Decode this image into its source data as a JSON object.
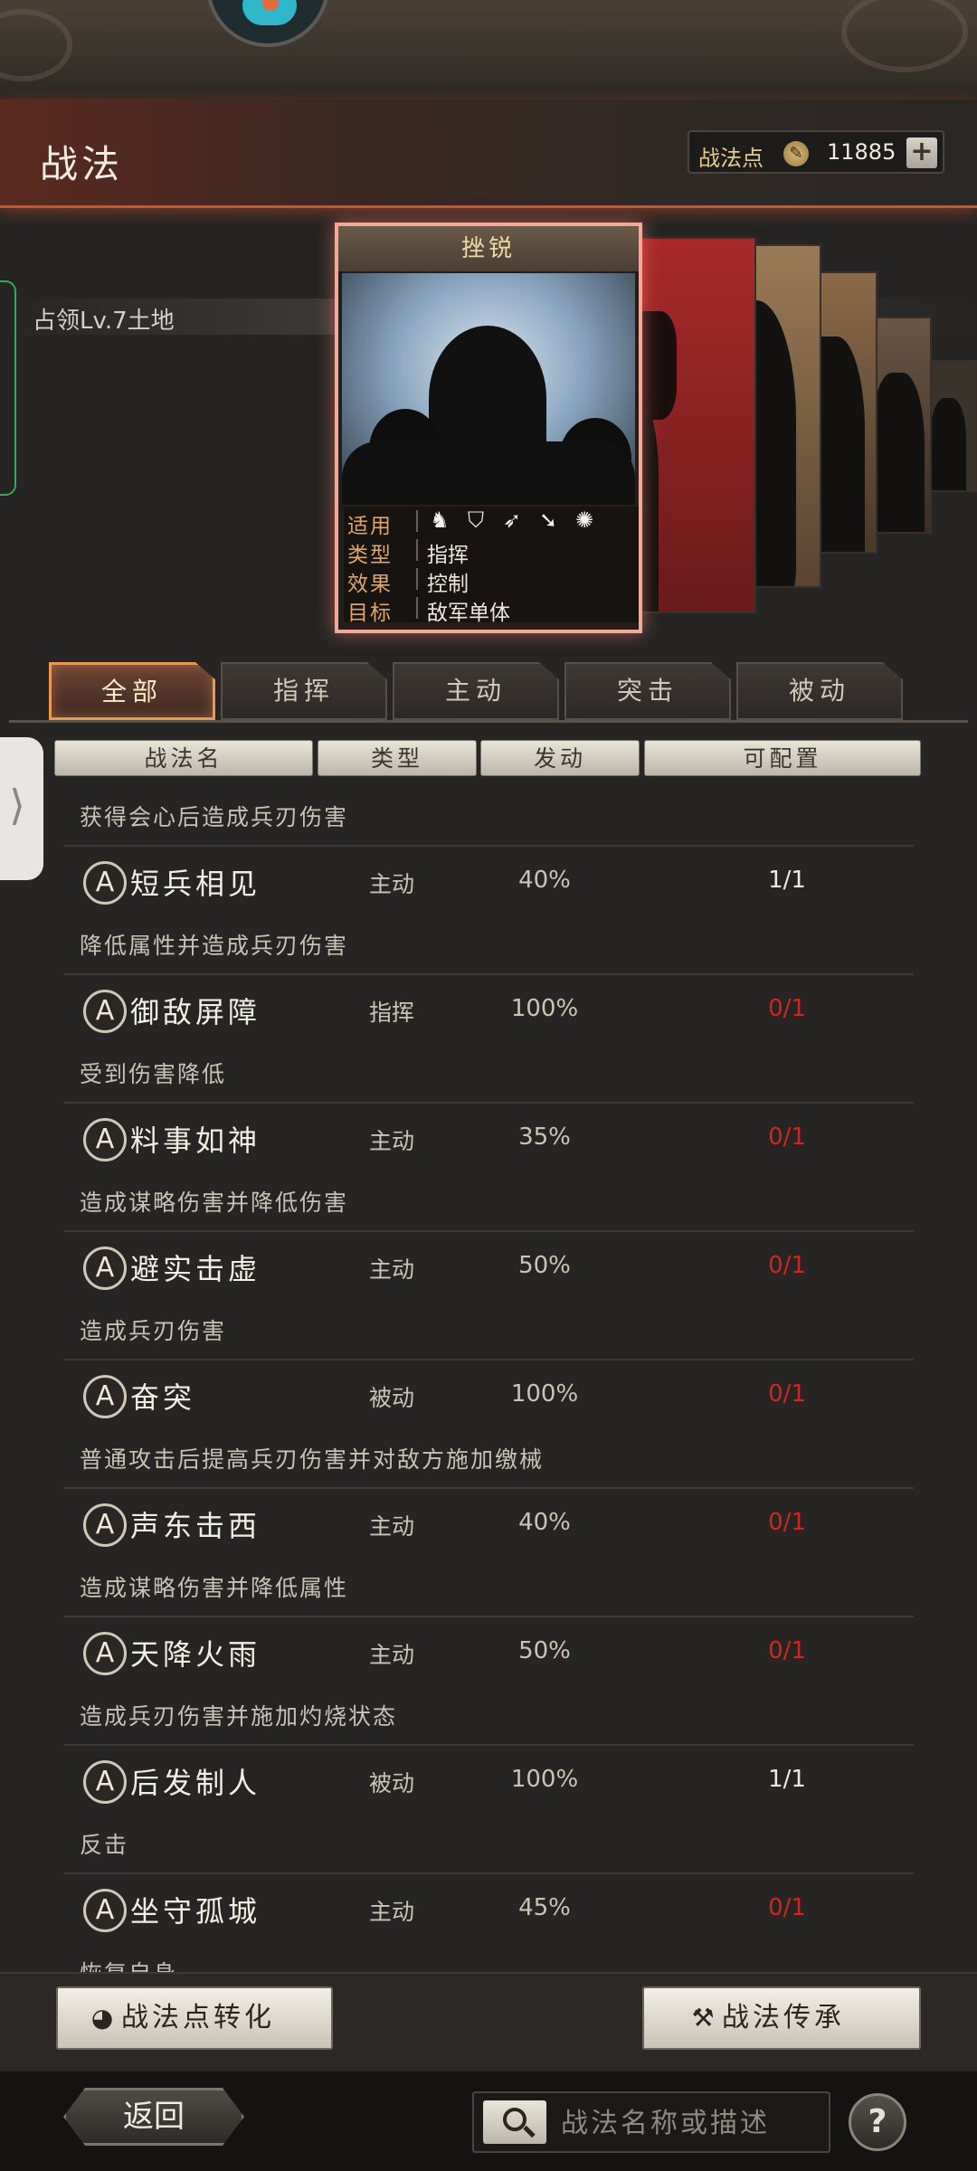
{
  "header": {
    "title": "战法",
    "points_label": "战法点",
    "points_value": "11885",
    "add_label": "+"
  },
  "territory_text": "占领Lv.7土地",
  "card": {
    "name": "挫锐",
    "rows": [
      {
        "key": "适用",
        "value": ""
      },
      {
        "key": "类型",
        "value": "指挥"
      },
      {
        "key": "效果",
        "value": "控制"
      },
      {
        "key": "目标",
        "value": "敌军单体"
      }
    ],
    "troop_icons": [
      "cavalry-icon",
      "shield-icon",
      "bow-icon",
      "spear-icon",
      "chariot-icon"
    ]
  },
  "tabs": [
    "全部",
    "指挥",
    "主动",
    "突击",
    "被动"
  ],
  "active_tab": "全部",
  "columns": [
    "战法名",
    "类型",
    "发动",
    "可配置"
  ],
  "list": {
    "top_desc": "获得会心后造成兵刃伤害",
    "rows": [
      {
        "grade": "A",
        "name": "短兵相见",
        "type": "主动",
        "rate": "40%",
        "config": "1/1",
        "config_color": "#f0ebe0",
        "desc": "降低属性并造成兵刃伤害"
      },
      {
        "grade": "A",
        "name": "御敌屏障",
        "type": "指挥",
        "rate": "100%",
        "config": "0/1",
        "config_color": "#d3251d",
        "desc": "受到伤害降低"
      },
      {
        "grade": "A",
        "name": "料事如神",
        "type": "主动",
        "rate": "35%",
        "config": "0/1",
        "config_color": "#d3251d",
        "desc": "造成谋略伤害并降低伤害"
      },
      {
        "grade": "A",
        "name": "避实击虚",
        "type": "主动",
        "rate": "50%",
        "config": "0/1",
        "config_color": "#d3251d",
        "desc": "造成兵刃伤害"
      },
      {
        "grade": "A",
        "name": "奋突",
        "type": "被动",
        "rate": "100%",
        "config": "0/1",
        "config_color": "#d3251d",
        "desc": "普通攻击后提高兵刃伤害并对敌方施加缴械"
      },
      {
        "grade": "A",
        "name": "声东击西",
        "type": "主动",
        "rate": "40%",
        "config": "0/1",
        "config_color": "#d3251d",
        "desc": "造成谋略伤害并降低属性"
      },
      {
        "grade": "A",
        "name": "天降火雨",
        "type": "主动",
        "rate": "50%",
        "config": "0/1",
        "config_color": "#d3251d",
        "desc": "造成兵刃伤害并施加灼烧状态"
      },
      {
        "grade": "A",
        "name": "后发制人",
        "type": "被动",
        "rate": "100%",
        "config": "1/1",
        "config_color": "#f0ebe0",
        "desc": "反击"
      },
      {
        "grade": "A",
        "name": "坐守孤城",
        "type": "主动",
        "rate": "45%",
        "config": "0/1",
        "config_color": "#d3251d",
        "desc": "恢复自身"
      }
    ]
  },
  "buttons": {
    "convert": "战法点转化",
    "inherit": "战法传承",
    "back": "返回",
    "help": "?"
  },
  "search": {
    "placeholder": "战法名称或描述"
  }
}
